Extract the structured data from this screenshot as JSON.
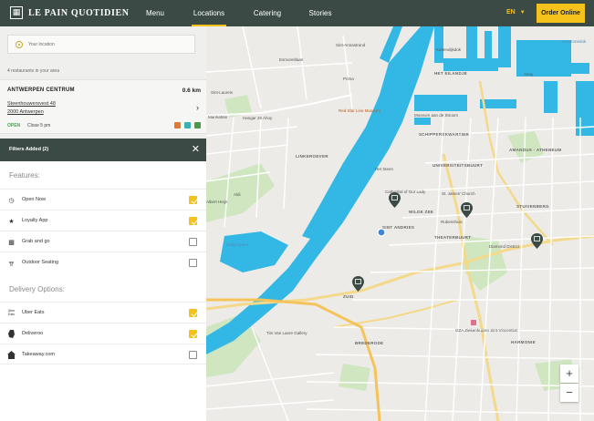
{
  "header": {
    "brand": "LE PAIN QUOTIDIEN",
    "nav": [
      "Menu",
      "Locations",
      "Catering",
      "Stories"
    ],
    "active_nav": "Locations",
    "language": "EN",
    "order_label": "Order Online",
    "accent_color": "#f4c21a",
    "bg_color": "#3b4a44"
  },
  "sidebar": {
    "search_placeholder": "Your location",
    "result_count": "4 restaurants in your area",
    "store": {
      "name": "ANTWERPEN CENTRUM",
      "distance": "0.6 km",
      "address_line1": "Steenhouwersvest 48",
      "address_line2": "2000 Antwerpen",
      "status": "OPEN",
      "close_time": "Close 5 pm"
    }
  },
  "filters": {
    "title": "Filters Added (2)",
    "features_title": "Features:",
    "features": [
      {
        "label": "Open Now",
        "icon": "clock-icon",
        "checked": true
      },
      {
        "label": "Loyalty App",
        "icon": "star-icon",
        "checked": true
      },
      {
        "label": "Grab and go",
        "icon": "bag-icon",
        "checked": false
      },
      {
        "label": "Outdoor Seating",
        "icon": "outdoor-table-icon",
        "checked": false
      }
    ],
    "delivery_title": "Delivery Options:",
    "delivery": [
      {
        "label": "Uber Eats",
        "icon": "uber-eats-icon",
        "checked": true
      },
      {
        "label": "Deliveroo",
        "icon": "deliveroo-icon",
        "checked": true
      },
      {
        "label": "Takeaway.com",
        "icon": "takeaway-icon",
        "checked": false
      }
    ]
  },
  "map": {
    "labels": {
      "sint_anneke": "Sint-Annastrand",
      "kattendijk": "Kattendijkdok",
      "esmoreit": "Esmoreitlaan",
      "amazonedok": "Amazonedok",
      "het_eilandje": "HET EILANDJE",
      "sint_laureis": "Sint-Laureis",
      "ahoy": "Ahoy",
      "manhattan": "Manhattan",
      "hangar": "Hangar 26 Ahoy",
      "reddin": "Red Star Line Museum",
      "mas": "Museum aan de Stroom",
      "het_steen": "Het Steen",
      "linkeroever": "LINKEROEVER",
      "schipperskwartier": "SCHIPPERSKWARTIER",
      "universiteitsbuurt": "UNIVERSITEITSBUURT",
      "amandus": "AMANDUS - ATHENEUM",
      "cathedral": "Cathedral of Our Lady",
      "st_james": "St. James' Church",
      "sint_andries": "SINT ANDRIES",
      "wilde_zee": "WILDE ZEE",
      "theaterbuurt": "THEATERBUURT",
      "rubenshuis": "Rubenshuis",
      "stuivenberg": "STUIVENBERG",
      "diamond_district": "Diamond District",
      "zuid": "ZUID",
      "brederode": "BREDERODE",
      "harmonie": "HARMONIE",
      "zna": "GZA Ziekenhuizen Sint-Vincentius",
      "tim_van_laere": "Tim Van Laere Gallery",
      "galgenweel": "Galgenweel",
      "scheldt": "Schelde",
      "prima": "Prima",
      "albert": "Albert Heijn",
      "aldi": "Aldi",
      "kwik": "Kwik Antwerp",
      "tramstraat": "Tramstraat"
    }
  }
}
